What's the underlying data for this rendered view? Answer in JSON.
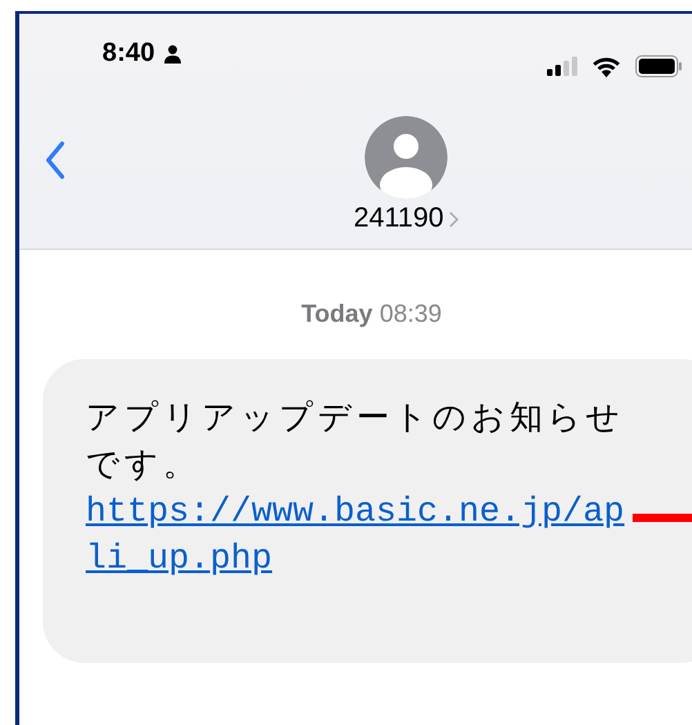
{
  "status_bar": {
    "time": "8:40"
  },
  "header": {
    "contact": "241190"
  },
  "timestamp": "**Today** 08:39",
  "messages": [
    {
      "text": "アプリアップデートのお知らせです。",
      "link": "https://www.basic.ne.jp/apli_up.php"
    }
  ]
}
